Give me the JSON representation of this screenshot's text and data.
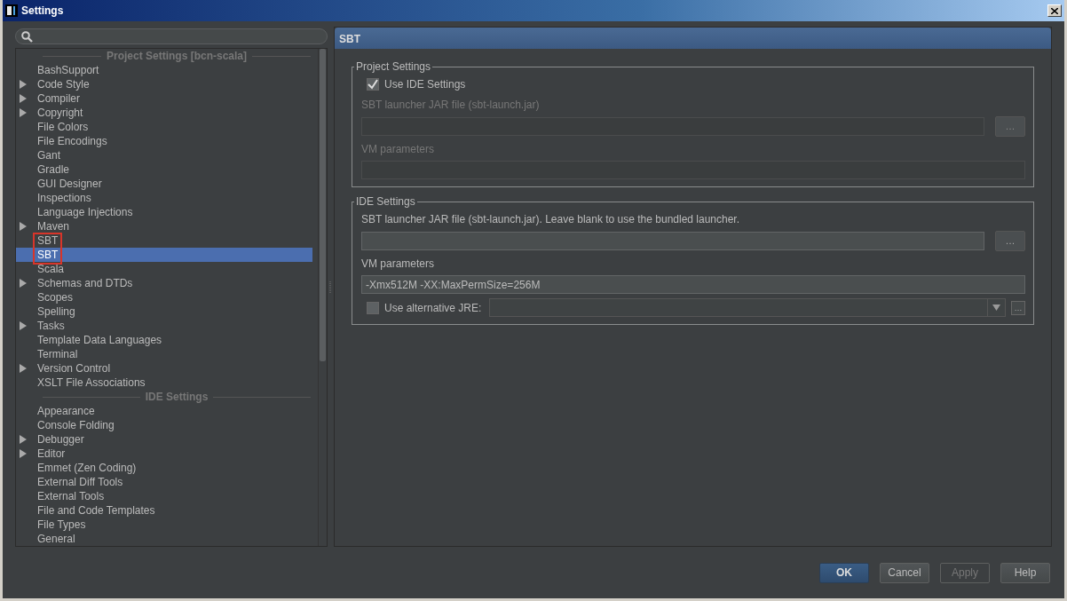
{
  "window": {
    "title": "Settings"
  },
  "tree": {
    "sections": [
      {
        "title": "Project Settings [bcn-scala]",
        "items": [
          {
            "label": "BashSupport",
            "expandable": false,
            "selected": false,
            "marked": false
          },
          {
            "label": "Code Style",
            "expandable": true,
            "selected": false,
            "marked": false
          },
          {
            "label": "Compiler",
            "expandable": true,
            "selected": false,
            "marked": false
          },
          {
            "label": "Copyright",
            "expandable": true,
            "selected": false,
            "marked": false
          },
          {
            "label": "File Colors",
            "expandable": false,
            "selected": false,
            "marked": false
          },
          {
            "label": "File Encodings",
            "expandable": false,
            "selected": false,
            "marked": false
          },
          {
            "label": "Gant",
            "expandable": false,
            "selected": false,
            "marked": false
          },
          {
            "label": "Gradle",
            "expandable": false,
            "selected": false,
            "marked": false
          },
          {
            "label": "GUI Designer",
            "expandable": false,
            "selected": false,
            "marked": false
          },
          {
            "label": "Inspections",
            "expandable": false,
            "selected": false,
            "marked": false
          },
          {
            "label": "Language Injections",
            "expandable": false,
            "selected": false,
            "marked": false
          },
          {
            "label": "Maven",
            "expandable": true,
            "selected": false,
            "marked": false
          },
          {
            "label": "SBT",
            "expandable": false,
            "selected": false,
            "marked": true
          },
          {
            "label": "SBT",
            "expandable": false,
            "selected": true,
            "marked": true
          },
          {
            "label": "Scala",
            "expandable": false,
            "selected": false,
            "marked": false
          },
          {
            "label": "Schemas and DTDs",
            "expandable": true,
            "selected": false,
            "marked": false
          },
          {
            "label": "Scopes",
            "expandable": false,
            "selected": false,
            "marked": false
          },
          {
            "label": "Spelling",
            "expandable": false,
            "selected": false,
            "marked": false
          },
          {
            "label": "Tasks",
            "expandable": true,
            "selected": false,
            "marked": false
          },
          {
            "label": "Template Data Languages",
            "expandable": false,
            "selected": false,
            "marked": false
          },
          {
            "label": "Terminal",
            "expandable": false,
            "selected": false,
            "marked": false
          },
          {
            "label": "Version Control",
            "expandable": true,
            "selected": false,
            "marked": false
          },
          {
            "label": "XSLT File Associations",
            "expandable": false,
            "selected": false,
            "marked": false
          }
        ]
      },
      {
        "title": "IDE Settings",
        "items": [
          {
            "label": "Appearance",
            "expandable": false,
            "selected": false,
            "marked": false
          },
          {
            "label": "Console Folding",
            "expandable": false,
            "selected": false,
            "marked": false
          },
          {
            "label": "Debugger",
            "expandable": true,
            "selected": false,
            "marked": false
          },
          {
            "label": "Editor",
            "expandable": true,
            "selected": false,
            "marked": false
          },
          {
            "label": "Emmet (Zen Coding)",
            "expandable": false,
            "selected": false,
            "marked": false
          },
          {
            "label": "External Diff Tools",
            "expandable": false,
            "selected": false,
            "marked": false
          },
          {
            "label": "External Tools",
            "expandable": false,
            "selected": false,
            "marked": false
          },
          {
            "label": "File and Code Templates",
            "expandable": false,
            "selected": false,
            "marked": false
          },
          {
            "label": "File Types",
            "expandable": false,
            "selected": false,
            "marked": false
          },
          {
            "label": "General",
            "expandable": false,
            "selected": false,
            "marked": false
          }
        ]
      }
    ]
  },
  "panel": {
    "title": "SBT",
    "groups": [
      {
        "title": "Project Settings",
        "rows": [
          {
            "kind": "checkbox",
            "label": "Use IDE Settings",
            "checked": true,
            "disabled": false
          },
          {
            "kind": "label",
            "text": "SBT launcher JAR file (sbt-launch.jar)",
            "disabled": true
          },
          {
            "kind": "browse",
            "button": "…",
            "disabled": true
          },
          {
            "kind": "label",
            "text": "VM parameters",
            "disabled": true
          },
          {
            "kind": "field",
            "disabled": true
          }
        ]
      },
      {
        "title": "IDE Settings",
        "rows": [
          {
            "kind": "label",
            "text": "SBT launcher JAR file (sbt-launch.jar). Leave blank to use the bundled launcher.",
            "disabled": false
          },
          {
            "kind": "browse",
            "button": "…",
            "disabled": false
          },
          {
            "kind": "label",
            "text": "VM parameters",
            "disabled": false
          },
          {
            "kind": "field",
            "value": "-Xmx512M -XX:MaxPermSize=256M",
            "disabled": false
          },
          {
            "kind": "combo",
            "label": "Use alternative JRE:",
            "button": "…",
            "checked": false,
            "disabled": false
          }
        ]
      }
    ]
  },
  "buttons": [
    {
      "label": "OK",
      "default": true,
      "disabled": false
    },
    {
      "label": "Cancel",
      "default": false,
      "disabled": false
    },
    {
      "label": "Apply",
      "default": false,
      "disabled": true
    },
    {
      "label": "Help",
      "default": false,
      "disabled": false
    }
  ]
}
